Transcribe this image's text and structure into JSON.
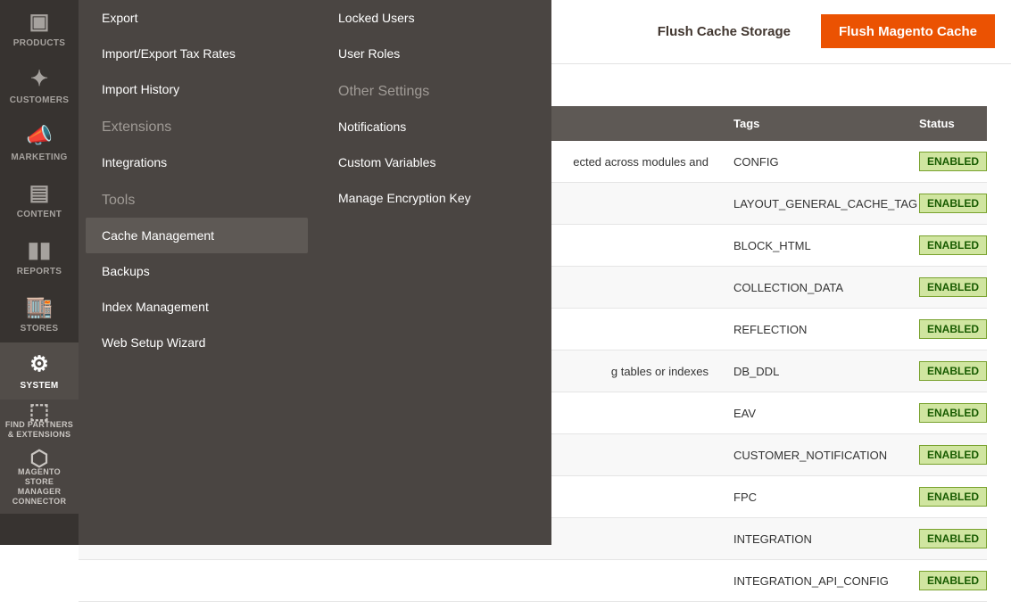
{
  "rail": {
    "products": "PRODUCTS",
    "customers": "CUSTOMERS",
    "marketing": "MARKETING",
    "content": "CONTENT",
    "reports": "REPORTS",
    "stores": "STORES",
    "system": "SYSTEM",
    "partners": "FIND PARTNERS & EXTENSIONS",
    "connector": "MAGENTO STORE MANAGER CONNECTOR"
  },
  "flyout": {
    "col1": {
      "items_top": [
        "Export",
        "Import/Export Tax Rates",
        "Import History"
      ],
      "extensions_title": "Extensions",
      "extensions_items": [
        "Integrations"
      ],
      "tools_title": "Tools",
      "tools_items": [
        "Cache Management",
        "Backups",
        "Index Management",
        "Web Setup Wizard"
      ]
    },
    "col2": {
      "items_top": [
        "Locked Users",
        "User Roles"
      ],
      "other_title": "Other Settings",
      "other_items": [
        "Notifications",
        "Custom Variables",
        "Manage Encryption Key"
      ]
    }
  },
  "actions": {
    "flush_storage": "Flush Cache Storage",
    "flush_magento": "Flush Magento Cache"
  },
  "table": {
    "headers": {
      "tags": "Tags",
      "status": "Status"
    },
    "rows": [
      {
        "desc": "ected across modules and",
        "tags": "CONFIG",
        "status": "ENABLED"
      },
      {
        "desc": "",
        "tags": "LAYOUT_GENERAL_CACHE_TAG",
        "status": "ENABLED"
      },
      {
        "desc": "",
        "tags": "BLOCK_HTML",
        "status": "ENABLED"
      },
      {
        "desc": "",
        "tags": "COLLECTION_DATA",
        "status": "ENABLED"
      },
      {
        "desc": "",
        "tags": "REFLECTION",
        "status": "ENABLED"
      },
      {
        "desc": "g tables or indexes",
        "tags": "DB_DDL",
        "status": "ENABLED"
      },
      {
        "desc": "",
        "tags": "EAV",
        "status": "ENABLED"
      },
      {
        "desc": "",
        "tags": "CUSTOMER_NOTIFICATION",
        "status": "ENABLED"
      },
      {
        "desc": "",
        "tags": "FPC",
        "status": "ENABLED"
      },
      {
        "desc": "",
        "tags": "INTEGRATION",
        "status": "ENABLED"
      },
      {
        "desc": "",
        "tags": "INTEGRATION_API_CONFIG",
        "status": "ENABLED"
      }
    ]
  }
}
